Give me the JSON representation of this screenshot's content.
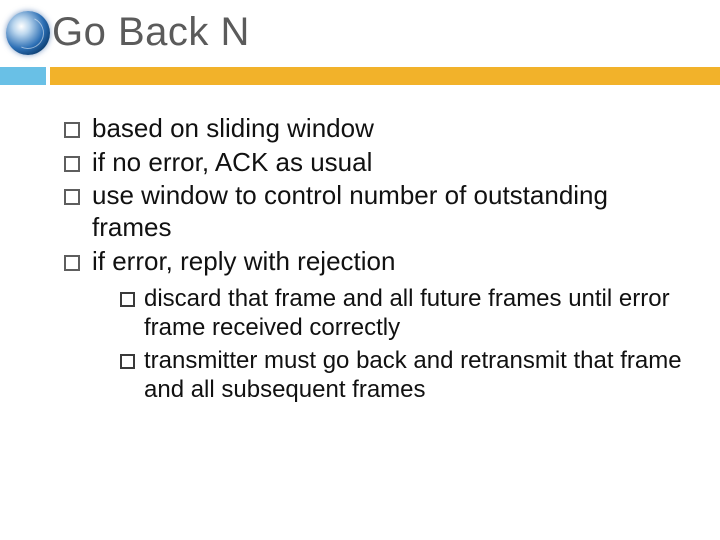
{
  "title": "Go Back N",
  "bullets": [
    "based on sliding window",
    "if no error, ACK as usual",
    "use window to control number of outstanding frames",
    "if error, reply with rejection"
  ],
  "subbullets": [
    "discard that frame and all future frames until error frame received correctly",
    "transmitter must go back and retransmit that frame and all subsequent frames"
  ]
}
